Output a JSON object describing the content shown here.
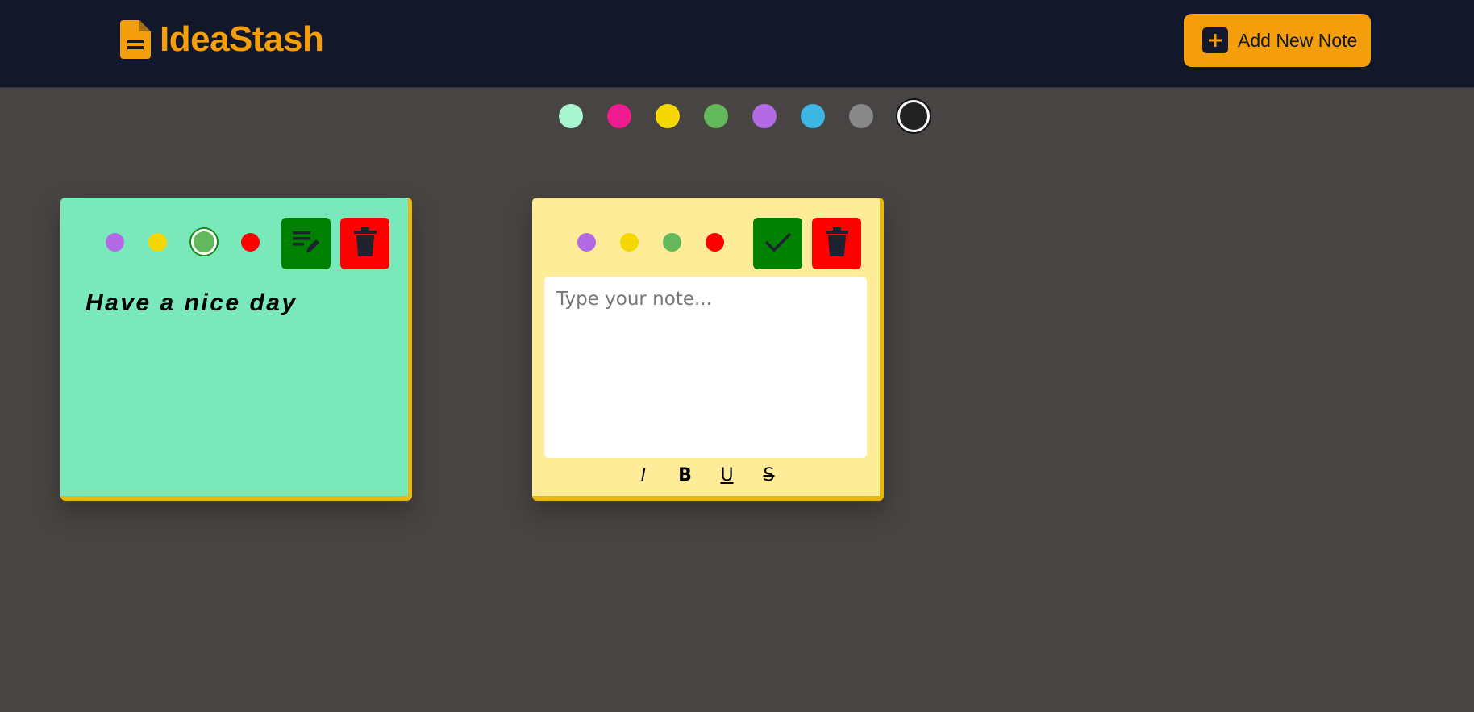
{
  "app": {
    "title": "IdeaStash",
    "logo_icon": "document-icon",
    "accent_color": "#f59e0b"
  },
  "header": {
    "add_button_label": "Add New Note",
    "add_button_icon": "plus-square-icon"
  },
  "palette": {
    "colors": [
      "#a8f5d2",
      "#ef1a8e",
      "#f5d800",
      "#62b85a",
      "#b26be5",
      "#3cb6e3",
      "#888888",
      "#222222"
    ],
    "selected": "#222222"
  },
  "notes": [
    {
      "id": "note-1",
      "text": "Have a nice day",
      "background": "#79e9bb",
      "mode": "view",
      "color_options": [
        "#b26be5",
        "#f5d800",
        "#62b85a",
        "#ff0000"
      ],
      "selected_color": "#62b85a",
      "edit_icon": "edit-note-icon",
      "delete_icon": "trash-icon"
    },
    {
      "id": "note-2",
      "text": "",
      "placeholder": "Type your note...",
      "background": "#ffec99",
      "mode": "edit",
      "color_options": [
        "#b26be5",
        "#f5d800",
        "#62b85a",
        "#ff0000"
      ],
      "selected_color": "",
      "save_icon": "checkmark-icon",
      "delete_icon": "trash-icon",
      "format_buttons": [
        "I",
        "B",
        "U",
        "S"
      ]
    }
  ]
}
